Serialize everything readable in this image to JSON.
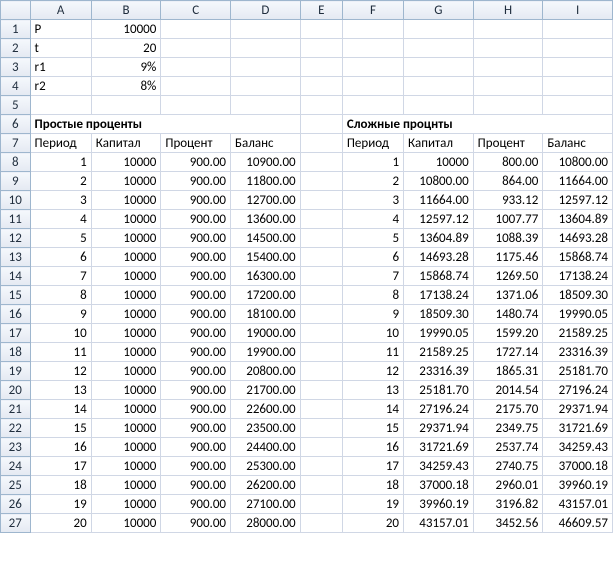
{
  "columns": [
    "A",
    "B",
    "C",
    "D",
    "E",
    "F",
    "G",
    "H",
    "I"
  ],
  "params": {
    "P_label": "P",
    "P_value": "10000",
    "t_label": "t",
    "t_value": "20",
    "r1_label": "r1",
    "r1_value": "9%",
    "r2_label": "r2",
    "r2_value": "8%"
  },
  "headings": {
    "simple": "Простые проценты",
    "compound": "Сложные процнты"
  },
  "subhead": {
    "period": "Период",
    "capital": "Капитал",
    "interest": "Процент",
    "balance": "Баланс"
  },
  "simple_rows": [
    {
      "n": "1",
      "cap": "10000",
      "int": "900.00",
      "bal": "10900.00"
    },
    {
      "n": "2",
      "cap": "10000",
      "int": "900.00",
      "bal": "11800.00"
    },
    {
      "n": "3",
      "cap": "10000",
      "int": "900.00",
      "bal": "12700.00"
    },
    {
      "n": "4",
      "cap": "10000",
      "int": "900.00",
      "bal": "13600.00"
    },
    {
      "n": "5",
      "cap": "10000",
      "int": "900.00",
      "bal": "14500.00"
    },
    {
      "n": "6",
      "cap": "10000",
      "int": "900.00",
      "bal": "15400.00"
    },
    {
      "n": "7",
      "cap": "10000",
      "int": "900.00",
      "bal": "16300.00"
    },
    {
      "n": "8",
      "cap": "10000",
      "int": "900.00",
      "bal": "17200.00"
    },
    {
      "n": "9",
      "cap": "10000",
      "int": "900.00",
      "bal": "18100.00"
    },
    {
      "n": "10",
      "cap": "10000",
      "int": "900.00",
      "bal": "19000.00"
    },
    {
      "n": "11",
      "cap": "10000",
      "int": "900.00",
      "bal": "19900.00"
    },
    {
      "n": "12",
      "cap": "10000",
      "int": "900.00",
      "bal": "20800.00"
    },
    {
      "n": "13",
      "cap": "10000",
      "int": "900.00",
      "bal": "21700.00"
    },
    {
      "n": "14",
      "cap": "10000",
      "int": "900.00",
      "bal": "22600.00"
    },
    {
      "n": "15",
      "cap": "10000",
      "int": "900.00",
      "bal": "23500.00"
    },
    {
      "n": "16",
      "cap": "10000",
      "int": "900.00",
      "bal": "24400.00"
    },
    {
      "n": "17",
      "cap": "10000",
      "int": "900.00",
      "bal": "25300.00"
    },
    {
      "n": "18",
      "cap": "10000",
      "int": "900.00",
      "bal": "26200.00"
    },
    {
      "n": "19",
      "cap": "10000",
      "int": "900.00",
      "bal": "27100.00"
    },
    {
      "n": "20",
      "cap": "10000",
      "int": "900.00",
      "bal": "28000.00"
    }
  ],
  "compound_rows": [
    {
      "n": "1",
      "cap": "10000",
      "int": "800.00",
      "bal": "10800.00"
    },
    {
      "n": "2",
      "cap": "10800.00",
      "int": "864.00",
      "bal": "11664.00"
    },
    {
      "n": "3",
      "cap": "11664.00",
      "int": "933.12",
      "bal": "12597.12"
    },
    {
      "n": "4",
      "cap": "12597.12",
      "int": "1007.77",
      "bal": "13604.89"
    },
    {
      "n": "5",
      "cap": "13604.89",
      "int": "1088.39",
      "bal": "14693.28"
    },
    {
      "n": "6",
      "cap": "14693.28",
      "int": "1175.46",
      "bal": "15868.74"
    },
    {
      "n": "7",
      "cap": "15868.74",
      "int": "1269.50",
      "bal": "17138.24"
    },
    {
      "n": "8",
      "cap": "17138.24",
      "int": "1371.06",
      "bal": "18509.30"
    },
    {
      "n": "9",
      "cap": "18509.30",
      "int": "1480.74",
      "bal": "19990.05"
    },
    {
      "n": "10",
      "cap": "19990.05",
      "int": "1599.20",
      "bal": "21589.25"
    },
    {
      "n": "11",
      "cap": "21589.25",
      "int": "1727.14",
      "bal": "23316.39"
    },
    {
      "n": "12",
      "cap": "23316.39",
      "int": "1865.31",
      "bal": "25181.70"
    },
    {
      "n": "13",
      "cap": "25181.70",
      "int": "2014.54",
      "bal": "27196.24"
    },
    {
      "n": "14",
      "cap": "27196.24",
      "int": "2175.70",
      "bal": "29371.94"
    },
    {
      "n": "15",
      "cap": "29371.94",
      "int": "2349.75",
      "bal": "31721.69"
    },
    {
      "n": "16",
      "cap": "31721.69",
      "int": "2537.74",
      "bal": "34259.43"
    },
    {
      "n": "17",
      "cap": "34259.43",
      "int": "2740.75",
      "bal": "37000.18"
    },
    {
      "n": "18",
      "cap": "37000.18",
      "int": "2960.01",
      "bal": "39960.19"
    },
    {
      "n": "19",
      "cap": "39960.19",
      "int": "3196.82",
      "bal": "43157.01"
    },
    {
      "n": "20",
      "cap": "43157.01",
      "int": "3452.56",
      "bal": "46609.57"
    }
  ],
  "row_numbers": [
    "1",
    "2",
    "3",
    "4",
    "5",
    "6",
    "7",
    "8",
    "9",
    "10",
    "11",
    "12",
    "13",
    "14",
    "15",
    "16",
    "17",
    "18",
    "19",
    "20",
    "21",
    "22",
    "23",
    "24",
    "25",
    "26",
    "27"
  ]
}
